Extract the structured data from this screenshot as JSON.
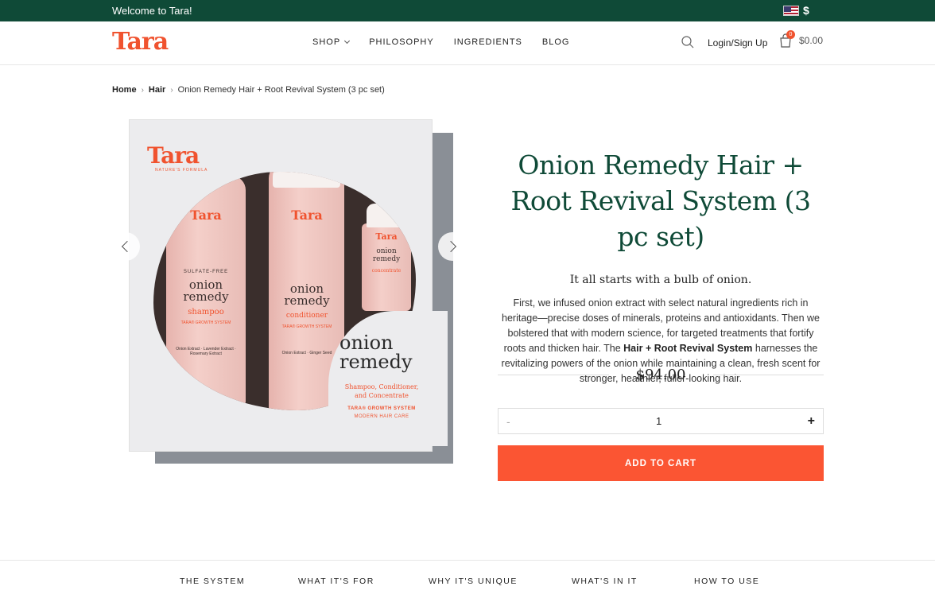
{
  "topbar": {
    "welcome": "Welcome to Tara!",
    "currency": "$"
  },
  "header": {
    "logo": "Tara",
    "nav": [
      {
        "label": "SHOP"
      },
      {
        "label": "PHILOSOPHY"
      },
      {
        "label": "INGREDIENTS"
      },
      {
        "label": "BLOG"
      }
    ],
    "login": "Login/Sign Up",
    "cart_count": "0",
    "cart_total": "$0.00"
  },
  "breadcrumb": [
    "Home",
    "Hair",
    "Onion Remedy Hair + Root Revival System (3 pc set)"
  ],
  "product_image": {
    "box_logo": "Tara",
    "box_logo_sub": "NATURE'S FORMULA",
    "bottles": [
      {
        "brand": "Tara",
        "top_line": "SULFATE-FREE",
        "name": "onion remedy",
        "type": "shampoo",
        "system": "TARA® GROWTH SYSTEM",
        "ingredients": "Onion Extract · Lavender Extract · Rosemary Extract"
      },
      {
        "brand": "Tara",
        "name": "onion remedy",
        "type": "conditioner",
        "system": "TARA® GROWTH SYSTEM",
        "ingredients": "Onion Extract · Ginger Seed"
      },
      {
        "brand": "Tara",
        "name": "onion remedy",
        "type": "concentrate"
      }
    ],
    "box_title": "onion remedy",
    "box_desc": "Shampoo, Conditioner, and Concentrate",
    "box_system": "TARA® GROWTH SYSTEM",
    "box_system_sub": "MODERN HAIR CARE"
  },
  "product": {
    "title": "Onion Remedy Hair + Root Revival System (3 pc set)",
    "tagline": "It all starts with a bulb of onion.",
    "desc_before": "First, we infused onion extract with select natural ingredients rich in heritage—precise doses of minerals, proteins and antioxidants. Then we bolstered that with modern science, for targeted treatments that fortify roots and thicken hair. The ",
    "desc_bold": "Hair + Root Revival System",
    "desc_after": " harnesses the revitalizing powers of the onion while maintaining a clean, fresh scent for stronger, healthier, fuller-looking hair.",
    "price": "$94.00",
    "quantity": "1",
    "minus": "-",
    "plus": "+",
    "add_to_cart": "ADD TO CART"
  },
  "tabs": [
    "THE SYSTEM",
    "WHAT IT'S FOR",
    "WHY IT'S UNIQUE",
    "WHAT'S IN IT",
    "HOW TO USE"
  ],
  "colors": {
    "brand_green": "#0f4a37",
    "brand_orange": "#f0532f",
    "cta": "#fb5533"
  }
}
